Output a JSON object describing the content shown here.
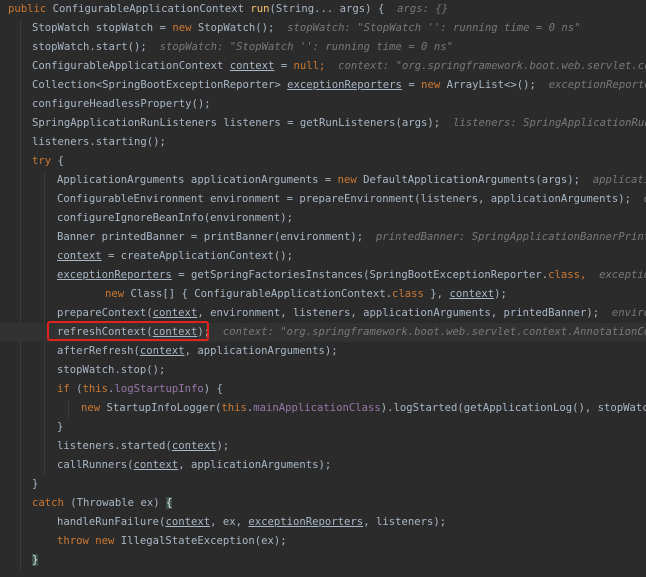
{
  "editor": {
    "lines": [
      {
        "indent": 0,
        "tokens": [
          {
            "t": "public ",
            "c": "t-kw"
          },
          {
            "t": "ConfigurableApplicationContext ",
            "c": "t-plain"
          },
          {
            "t": "run",
            "c": "t-fn"
          },
          {
            "t": "(String... args) {  ",
            "c": "t-plain"
          },
          {
            "t": "args: {}",
            "c": "t-hint"
          }
        ]
      },
      {
        "indent": 1,
        "tokens": [
          {
            "t": "StopWatch stopWatch = ",
            "c": "t-plain"
          },
          {
            "t": "new ",
            "c": "t-kw"
          },
          {
            "t": "StopWatch();  ",
            "c": "t-plain"
          },
          {
            "t": "stopWatch: \"StopWatch '': running time = 0 ns\"",
            "c": "t-hint"
          }
        ]
      },
      {
        "indent": 1,
        "tokens": [
          {
            "t": "stopWatch.start();  ",
            "c": "t-plain"
          },
          {
            "t": "stopWatch: \"StopWatch '': running time = 0 ns\"",
            "c": "t-hint"
          }
        ]
      },
      {
        "indent": 1,
        "tokens": [
          {
            "t": "ConfigurableApplicationContext ",
            "c": "t-plain"
          },
          {
            "t": "context",
            "c": "t-ul"
          },
          {
            "t": " = ",
            "c": "t-plain"
          },
          {
            "t": "null",
            "c": "t-kw"
          },
          {
            "t": ";  ",
            "c": "t-kw"
          },
          {
            "t": "context: \"org.springframework.boot.web.servlet.context",
            "c": "t-hint"
          }
        ]
      },
      {
        "indent": 1,
        "tokens": [
          {
            "t": "Collection<SpringBootExceptionReporter> ",
            "c": "t-plain"
          },
          {
            "t": "exceptionReporters",
            "c": "t-ul"
          },
          {
            "t": " = ",
            "c": "t-plain"
          },
          {
            "t": "new ",
            "c": "t-kw"
          },
          {
            "t": "ArrayList<>();  ",
            "c": "t-plain"
          },
          {
            "t": "exceptionReporters:",
            "c": "t-hint"
          }
        ]
      },
      {
        "indent": 1,
        "tokens": [
          {
            "t": "configureHeadlessProperty();",
            "c": "t-plain"
          }
        ]
      },
      {
        "indent": 1,
        "tokens": [
          {
            "t": "SpringApplicationRunListeners listeners = getRunListeners(args);  ",
            "c": "t-plain"
          },
          {
            "t": "listeners: SpringApplicationRunListeners",
            "c": "t-hint"
          }
        ]
      },
      {
        "indent": 1,
        "tokens": [
          {
            "t": "listeners.starting();",
            "c": "t-plain"
          }
        ]
      },
      {
        "indent": 1,
        "tokens": [
          {
            "t": "try ",
            "c": "t-kw"
          },
          {
            "t": "{",
            "c": "t-plain"
          }
        ]
      },
      {
        "indent": 2,
        "tokens": [
          {
            "t": "ApplicationArguments applicationArguments = ",
            "c": "t-plain"
          },
          {
            "t": "new ",
            "c": "t-kw"
          },
          {
            "t": "DefaultApplicationArguments(args);  ",
            "c": "t-plain"
          },
          {
            "t": "applicationArg",
            "c": "t-hint"
          }
        ]
      },
      {
        "indent": 2,
        "tokens": [
          {
            "t": "ConfigurableEnvironment environment = prepareEnvironment(listeners, applicationArguments);  ",
            "c": "t-plain"
          },
          {
            "t": "enviro",
            "c": "t-hint"
          }
        ]
      },
      {
        "indent": 2,
        "tokens": [
          {
            "t": "configureIgnoreBeanInfo(environment);",
            "c": "t-plain"
          }
        ]
      },
      {
        "indent": 2,
        "tokens": [
          {
            "t": "Banner printedBanner = printBanner(environment);  ",
            "c": "t-plain"
          },
          {
            "t": "printedBanner: SpringApplicationBannerPrinter$Pr",
            "c": "t-hint"
          }
        ]
      },
      {
        "indent": 2,
        "tokens": [
          {
            "t": "context",
            "c": "t-ul"
          },
          {
            "t": " = createApplicationContext();",
            "c": "t-plain"
          }
        ]
      },
      {
        "indent": 2,
        "tokens": [
          {
            "t": "exceptionReporters",
            "c": "t-ul"
          },
          {
            "t": " = getSpringFactoriesInstances(SpringBootExceptionReporter.",
            "c": "t-plain"
          },
          {
            "t": "class",
            "c": "t-kw"
          },
          {
            "t": ",  ",
            "c": "t-kw"
          },
          {
            "t": "exceptionRepor",
            "c": "t-hint"
          }
        ]
      },
      {
        "indent": 4,
        "tokens": [
          {
            "t": "new ",
            "c": "t-kw"
          },
          {
            "t": "Class[] { ConfigurableApplicationContext.",
            "c": "t-plain"
          },
          {
            "t": "class ",
            "c": "t-kw"
          },
          {
            "t": "}, ",
            "c": "t-plain"
          },
          {
            "t": "context",
            "c": "t-ul"
          },
          {
            "t": ");",
            "c": "t-plain"
          }
        ]
      },
      {
        "indent": 2,
        "tokens": [
          {
            "t": "prepareContext(",
            "c": "t-plain"
          },
          {
            "t": "context",
            "c": "t-ul"
          },
          {
            "t": ", environment, listeners, applicationArguments, printedBanner);  ",
            "c": "t-plain"
          },
          {
            "t": "environment",
            "c": "t-hint"
          }
        ]
      },
      {
        "indent": 2,
        "current": true,
        "tokens": [
          {
            "t": "refreshContext(",
            "c": "t-plain"
          },
          {
            "t": "context",
            "c": "t-ul"
          },
          {
            "t": ");  ",
            "c": "t-plain"
          },
          {
            "t": "context: \"org.springframework.boot.web.servlet.context.AnnotationConfigS",
            "c": "t-hint"
          }
        ]
      },
      {
        "indent": 2,
        "tokens": [
          {
            "t": "afterRefresh(",
            "c": "t-plain"
          },
          {
            "t": "context",
            "c": "t-ul"
          },
          {
            "t": ", applicationArguments);",
            "c": "t-plain"
          }
        ]
      },
      {
        "indent": 2,
        "tokens": [
          {
            "t": "stopWatch.stop();",
            "c": "t-plain"
          }
        ]
      },
      {
        "indent": 2,
        "tokens": [
          {
            "t": "if ",
            "c": "t-kw"
          },
          {
            "t": "(",
            "c": "t-plain"
          },
          {
            "t": "this",
            "c": "t-kw"
          },
          {
            "t": ".",
            "c": "t-plain"
          },
          {
            "t": "logStartupInfo",
            "c": "t-field"
          },
          {
            "t": ") {",
            "c": "t-plain"
          }
        ]
      },
      {
        "indent": 3,
        "tokens": [
          {
            "t": "new ",
            "c": "t-kw"
          },
          {
            "t": "StartupInfoLogger(",
            "c": "t-plain"
          },
          {
            "t": "this",
            "c": "t-kw"
          },
          {
            "t": ".",
            "c": "t-plain"
          },
          {
            "t": "mainApplicationClass",
            "c": "t-field"
          },
          {
            "t": ").logStarted(getApplicationLog(), stopWatch);",
            "c": "t-plain"
          }
        ]
      },
      {
        "indent": 2,
        "tokens": [
          {
            "t": "}",
            "c": "t-plain"
          }
        ]
      },
      {
        "indent": 2,
        "tokens": [
          {
            "t": "listeners.started(",
            "c": "t-plain"
          },
          {
            "t": "context",
            "c": "t-ul"
          },
          {
            "t": ");",
            "c": "t-plain"
          }
        ]
      },
      {
        "indent": 2,
        "tokens": [
          {
            "t": "callRunners(",
            "c": "t-plain"
          },
          {
            "t": "context",
            "c": "t-ul"
          },
          {
            "t": ", applicationArguments);",
            "c": "t-plain"
          }
        ]
      },
      {
        "indent": 1,
        "tokens": [
          {
            "t": "}",
            "c": "t-plain"
          }
        ]
      },
      {
        "indent": 1,
        "tokens": [
          {
            "t": "catch ",
            "c": "t-kw"
          },
          {
            "t": "(Throwable ex) ",
            "c": "t-plain"
          },
          {
            "t": "{",
            "c": "caret-brace"
          }
        ]
      },
      {
        "indent": 2,
        "tokens": [
          {
            "t": "handleRunFailure(",
            "c": "t-plain"
          },
          {
            "t": "context",
            "c": "t-ul"
          },
          {
            "t": ", ex, ",
            "c": "t-plain"
          },
          {
            "t": "exceptionReporters",
            "c": "t-ul"
          },
          {
            "t": ", listeners);",
            "c": "t-plain"
          }
        ]
      },
      {
        "indent": 2,
        "tokens": [
          {
            "t": "throw new ",
            "c": "t-kw"
          },
          {
            "t": "IllegalStateException(ex);",
            "c": "t-plain"
          }
        ]
      },
      {
        "indent": 1,
        "tokens": [
          {
            "t": "}",
            "c": "caret-brace"
          }
        ]
      }
    ]
  },
  "colors": {
    "background": "#2b2b2b",
    "keyword": "#cc7832",
    "method": "#ffc66d",
    "text": "#a9b7c6",
    "field": "#9876aa",
    "hint": "#787878",
    "highlight_box": "#e0241b",
    "current_line": "#323232"
  }
}
